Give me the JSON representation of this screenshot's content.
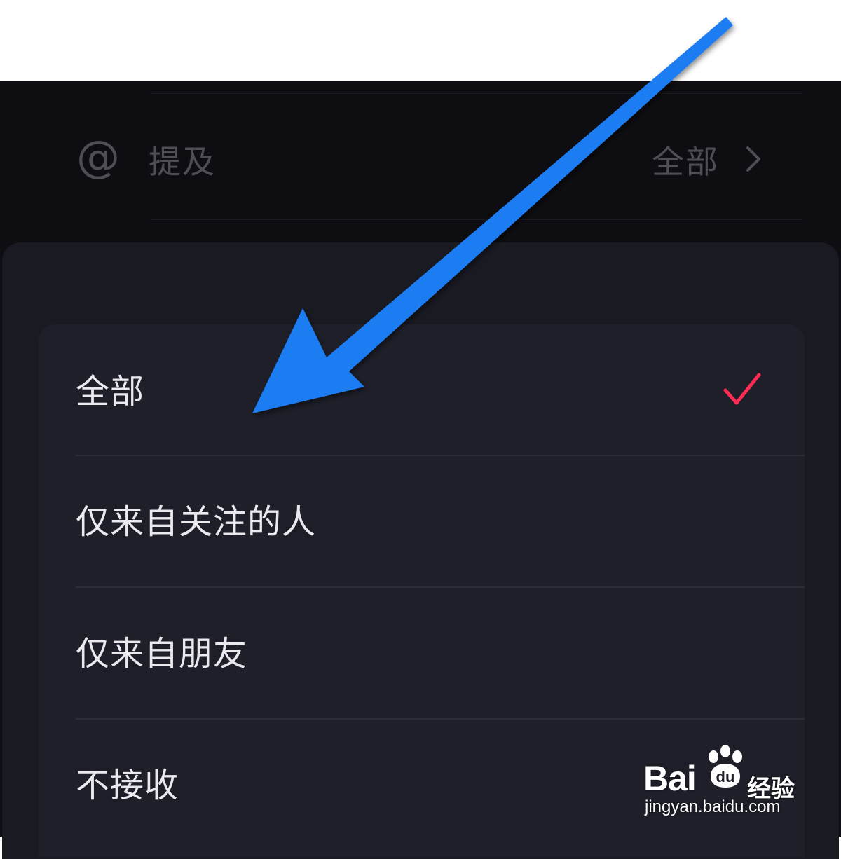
{
  "mention_setting": {
    "icon": "at-icon",
    "label": "提及",
    "value": "全部"
  },
  "options": [
    {
      "label": "全部",
      "selected": true
    },
    {
      "label": "仅来自关注的人",
      "selected": false
    },
    {
      "label": "仅来自朋友",
      "selected": false
    },
    {
      "label": "不接收",
      "selected": false
    }
  ],
  "watermark": {
    "brand": "Bai",
    "brand_suffix": "经验",
    "url": "jingyan.baidu.com"
  },
  "colors": {
    "accent_check": "#fe2c55",
    "annotation_arrow": "#1f7cf2"
  }
}
